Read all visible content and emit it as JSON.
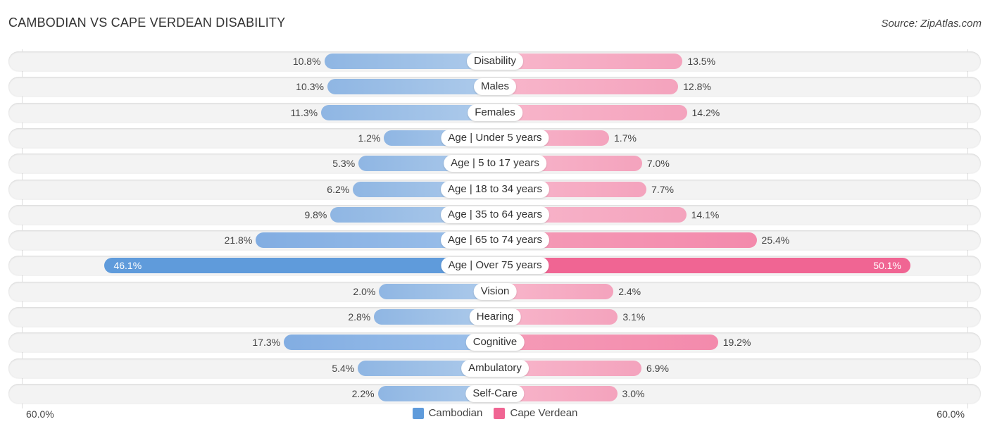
{
  "chart_data": {
    "type": "bar",
    "orientation": "horizontal-diverging",
    "title": "CAMBODIAN VS CAPE VERDEAN DISABILITY",
    "source": "Source: ZipAtlas.com",
    "categories": [
      "Disability",
      "Males",
      "Females",
      "Age | Under 5 years",
      "Age | 5 to 17 years",
      "Age | 18 to 34 years",
      "Age | 35 to 64 years",
      "Age | 65 to 74 years",
      "Age | Over 75 years",
      "Vision",
      "Hearing",
      "Cognitive",
      "Ambulatory",
      "Self-Care"
    ],
    "series": [
      {
        "name": "Cambodian",
        "color": "#5f9bdb",
        "values": [
          10.8,
          10.3,
          11.3,
          1.2,
          5.3,
          6.2,
          9.8,
          21.8,
          46.1,
          2.0,
          2.8,
          17.3,
          5.4,
          2.2
        ]
      },
      {
        "name": "Cape Verdean",
        "color": "#f06593",
        "values": [
          13.5,
          12.8,
          14.2,
          1.7,
          7.0,
          7.7,
          14.1,
          25.4,
          50.1,
          2.4,
          3.1,
          19.2,
          6.9,
          3.0
        ]
      }
    ],
    "axis": {
      "left_label": "60.0%",
      "right_label": "60.0%",
      "max": 60.0
    },
    "unit": "%",
    "legend_position": "bottom-center"
  }
}
